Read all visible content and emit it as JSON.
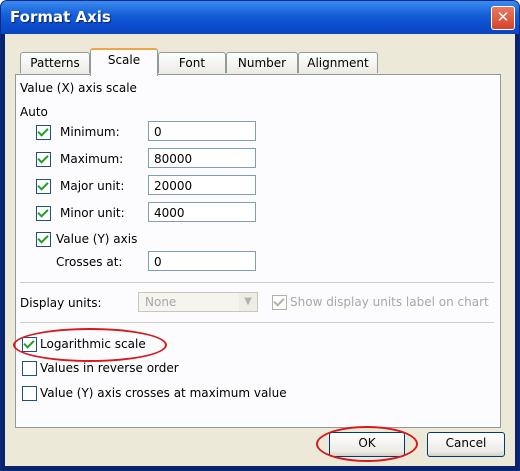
{
  "window": {
    "title": "Format Axis",
    "close_label": "✕"
  },
  "tabs": [
    {
      "label": "Patterns",
      "active": false
    },
    {
      "label": "Scale",
      "active": true
    },
    {
      "label": "Font",
      "active": false
    },
    {
      "label": "Number",
      "active": false
    },
    {
      "label": "Alignment",
      "active": false
    }
  ],
  "scale": {
    "section_title": "Value (X) axis scale",
    "auto_label": "Auto",
    "minimum": {
      "label": "Minimum:",
      "checked": true,
      "value": "0"
    },
    "maximum": {
      "label": "Maximum:",
      "checked": true,
      "value": "80000"
    },
    "major_unit": {
      "label": "Major unit:",
      "checked": true,
      "value": "20000"
    },
    "minor_unit": {
      "label": "Minor unit:",
      "checked": true,
      "value": "4000"
    },
    "value_y_axis": {
      "label": "Value (Y) axis",
      "checked": true
    },
    "crosses_at": {
      "label": "Crosses at:",
      "value": "0"
    },
    "display_units": {
      "label": "Display units:",
      "selected": "None",
      "enabled": false
    },
    "show_units_label": {
      "label": "Show display units label on chart",
      "checked": true,
      "enabled": false
    },
    "logarithmic": {
      "label": "Logarithmic scale",
      "checked": true
    },
    "reverse_order": {
      "label": "Values in reverse order",
      "checked": false
    },
    "crosses_max": {
      "label": "Value (Y) axis crosses at maximum value",
      "checked": false
    }
  },
  "buttons": {
    "ok": "OK",
    "cancel": "Cancel"
  },
  "colors": {
    "highlight_ellipse": "#d7191c",
    "titlebar": "#0c4fd0"
  }
}
